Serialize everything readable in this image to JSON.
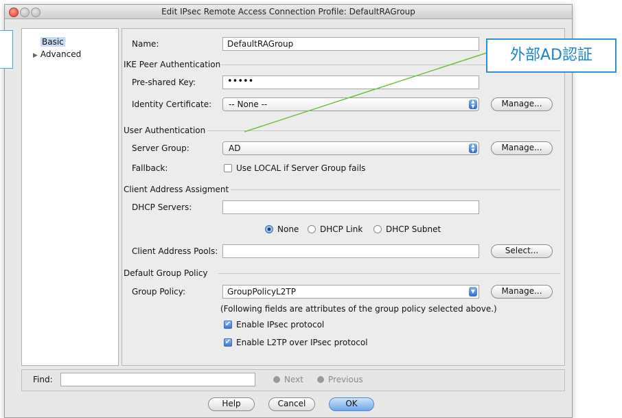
{
  "window": {
    "title": "Edit IPsec Remote Access Connection Profile: DefaultRAGroup"
  },
  "tree": {
    "items": [
      {
        "label": "Basic"
      },
      {
        "label": "Advanced"
      }
    ]
  },
  "form": {
    "name_label": "Name:",
    "name_value": "DefaultRAGroup",
    "ike_section": "IKE Peer Authentication",
    "psk_label": "Pre-shared Key:",
    "psk_value": "•••••",
    "identity_label": "Identity Certificate:",
    "identity_value": "-- None --",
    "manage_label": "Manage...",
    "user_auth_section": "User Authentication",
    "server_group_label": "Server Group:",
    "server_group_value": "AD",
    "fallback_label": "Fallback:",
    "fallback_checkbox_label": "Use LOCAL if Server Group fails",
    "fallback_checked": false,
    "client_addr_section": "Client Address Assigment",
    "dhcp_label": "DHCP Servers:",
    "dhcp_value": "",
    "radio_options": [
      {
        "label": "None",
        "selected": true
      },
      {
        "label": "DHCP Link",
        "selected": false
      },
      {
        "label": "DHCP Subnet",
        "selected": false
      }
    ],
    "pools_label": "Client Address Pools:",
    "pools_value": "",
    "select_label": "Select...",
    "group_policy_section": "Default Group Policy",
    "group_policy_label": "Group Policy:",
    "group_policy_value": "GroupPolicyL2TP",
    "note": "(Following fields are attributes of the group policy selected above.)",
    "ipsec_label": "Enable IPsec protocol",
    "ipsec_checked": true,
    "l2tp_label": "Enable L2TP over IPsec protocol",
    "l2tp_checked": true
  },
  "find": {
    "label": "Find:",
    "value": "",
    "next_label": "Next",
    "previous_label": "Previous"
  },
  "buttons": {
    "help": "Help",
    "cancel": "Cancel",
    "ok": "OK"
  },
  "callout": {
    "text": "外部AD認証",
    "color": "#1a84c9",
    "line_color": "#6cbf3c"
  }
}
